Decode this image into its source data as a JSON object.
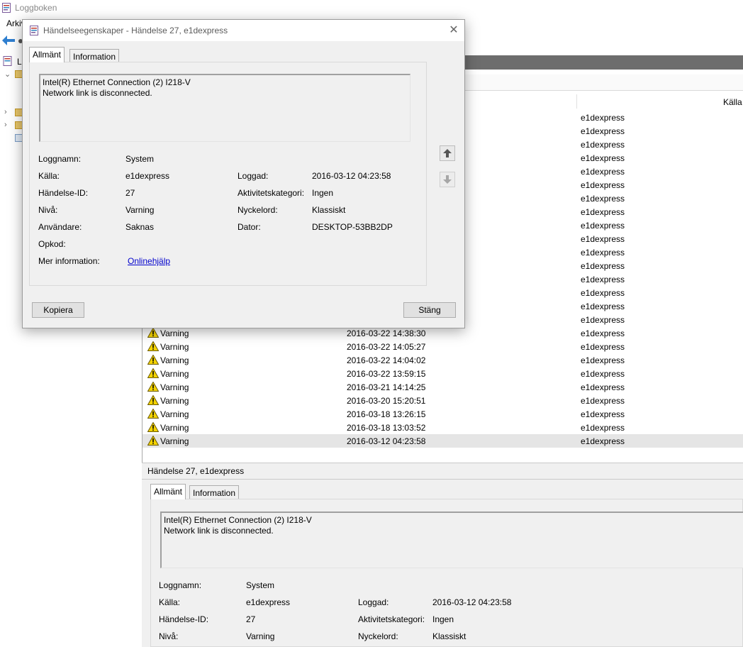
{
  "app": {
    "title": "Loggboken",
    "menu_first": "Arkiv"
  },
  "tree": {
    "root_label": "Lo"
  },
  "columns": {
    "source": "Källa"
  },
  "events": [
    {
      "level": "",
      "date": "",
      "source": "e1dexpress"
    },
    {
      "level": "",
      "date": "",
      "source": "e1dexpress"
    },
    {
      "level": "",
      "date": "",
      "source": "e1dexpress"
    },
    {
      "level": "",
      "date": "",
      "source": "e1dexpress"
    },
    {
      "level": "",
      "date": "",
      "source": "e1dexpress"
    },
    {
      "level": "",
      "date": "",
      "source": "e1dexpress"
    },
    {
      "level": "",
      "date": "",
      "source": "e1dexpress"
    },
    {
      "level": "",
      "date": "",
      "source": "e1dexpress"
    },
    {
      "level": "",
      "date": "",
      "source": "e1dexpress"
    },
    {
      "level": "",
      "date": "",
      "source": "e1dexpress"
    },
    {
      "level": "",
      "date": "",
      "source": "e1dexpress"
    },
    {
      "level": "",
      "date": "",
      "source": "e1dexpress"
    },
    {
      "level": "",
      "date": "",
      "source": "e1dexpress"
    },
    {
      "level": "",
      "date": "",
      "source": "e1dexpress"
    },
    {
      "level": "",
      "date": "",
      "source": "e1dexpress"
    },
    {
      "level": "",
      "date": "",
      "source": "e1dexpress"
    },
    {
      "level": "Varning",
      "date": "2016-03-22 14:38:30",
      "source": "e1dexpress"
    },
    {
      "level": "Varning",
      "date": "2016-03-22 14:05:27",
      "source": "e1dexpress"
    },
    {
      "level": "Varning",
      "date": "2016-03-22 14:04:02",
      "source": "e1dexpress"
    },
    {
      "level": "Varning",
      "date": "2016-03-22 13:59:15",
      "source": "e1dexpress"
    },
    {
      "level": "Varning",
      "date": "2016-03-21 14:14:25",
      "source": "e1dexpress"
    },
    {
      "level": "Varning",
      "date": "2016-03-20 15:20:51",
      "source": "e1dexpress"
    },
    {
      "level": "Varning",
      "date": "2016-03-18 13:26:15",
      "source": "e1dexpress"
    },
    {
      "level": "Varning",
      "date": "2016-03-18 13:03:52",
      "source": "e1dexpress"
    },
    {
      "level": "Varning",
      "date": "2016-03-12 04:23:58",
      "source": "e1dexpress"
    }
  ],
  "details": {
    "title": "Händelse 27, e1dexpress",
    "tab_general": "Allmänt",
    "tab_info": "Information",
    "message_line1": "Intel(R) Ethernet Connection (2) I218-V",
    "message_line2": "Network link is disconnected.",
    "log_name_label": "Loggnamn:",
    "log_name": "System",
    "source_label": "Källa:",
    "source": "e1dexpress",
    "logged_label": "Loggad:",
    "logged": "2016-03-12 04:23:58",
    "event_id_label": "Händelse-ID:",
    "event_id": "27",
    "category_label": "Aktivitetskategori:",
    "category": "Ingen",
    "level_label": "Nivå:",
    "level": "Varning",
    "keyword_label": "Nyckelord:",
    "keyword": "Klassiskt"
  },
  "dialog": {
    "title": "Händelseegenskaper - Händelse 27, e1dexpress",
    "close": "✕",
    "tab_general": "Allmänt",
    "tab_info": "Information",
    "message_line1": "Intel(R) Ethernet Connection (2) I218-V",
    "message_line2": "Network link is disconnected.",
    "log_name_label": "Loggnamn:",
    "log_name": "System",
    "source_label": "Källa:",
    "source": "e1dexpress",
    "logged_label": "Loggad:",
    "logged": "2016-03-12 04:23:58",
    "event_id_label": "Händelse-ID:",
    "event_id": "27",
    "category_label": "Aktivitetskategori:",
    "category": "Ingen",
    "level_label": "Nivå:",
    "level": "Varning",
    "keyword_label": "Nyckelord:",
    "keyword": "Klassiskt",
    "user_label": "Användare:",
    "user": "Saknas",
    "computer_label": "Dator:",
    "computer": "DESKTOP-53BB2DP",
    "opcode_label": "Opkod:",
    "opcode": "",
    "more_info_label": "Mer information:",
    "more_info_link": "Onlinehjälp",
    "copy_button": "Kopiera",
    "close_button": "Stäng"
  },
  "colors": {
    "warning_yellow": "#f5d400",
    "pane_header": "#6d6d6d",
    "link": "#0000cc"
  }
}
